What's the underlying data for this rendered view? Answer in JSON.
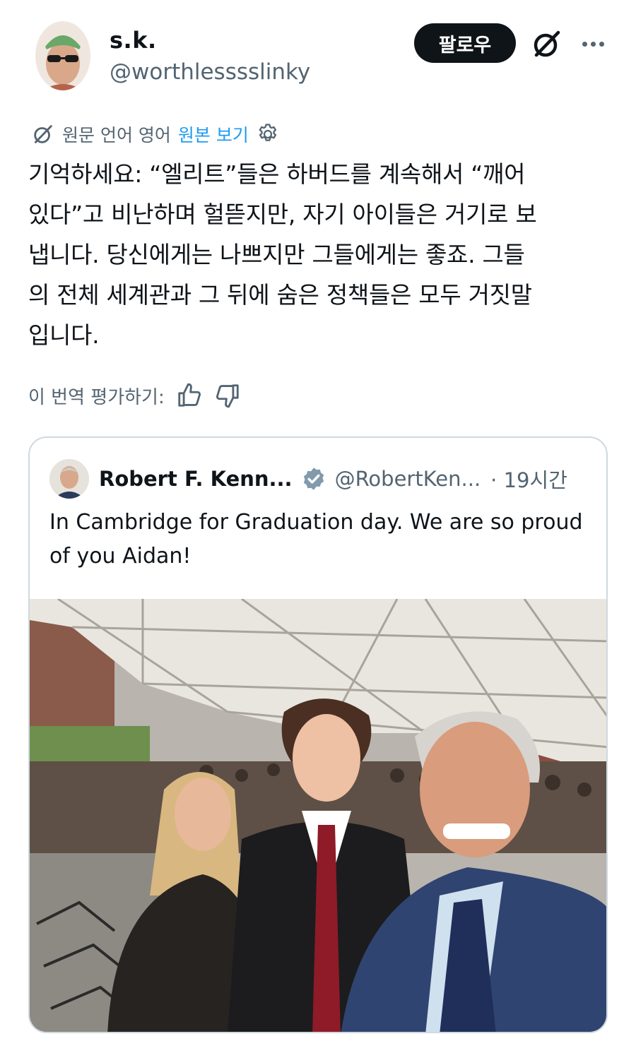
{
  "author": {
    "display_name": "s.k.",
    "handle": "@worthlesssslinky",
    "follow_label": "팔로우"
  },
  "translation": {
    "source_label": "원문 언어 영어",
    "show_original": "원본 보기"
  },
  "tweet": {
    "lines": [
      "기억하세요: “엘리트”들은 하버드를 계속해서 “깨어",
      "있다”고 비난하며 헐뜯지만, 자기 아이들은 거기로 보",
      "냅니다. 당신에게는 나쁘지만 그들에게는 좋죠. 그들",
      "의 전체 세계관과 그 뒤에 숨은 정책들은 모두 거짓말",
      "입니다."
    ]
  },
  "rate": {
    "label": "이 번역 평가하기:"
  },
  "quote": {
    "name": "Robert F. Kenn...",
    "handle": "@RobertKen...",
    "time": "· 19시간",
    "text": "In Cambridge for Graduation day. We are so proud of you Aidan!"
  },
  "colors": {
    "text": "#0f1419",
    "secondary": "#536471",
    "link": "#1d9bf0",
    "border": "#cfd9de",
    "verified_badge": "#829aab"
  },
  "icons": {
    "grok": "slashed-circle-icon",
    "more": "ellipsis-icon",
    "translate": "slashed-circle-icon",
    "settings": "gear-icon",
    "like": "thumbs-up-icon",
    "dislike": "thumbs-down-icon",
    "verified": "verified-badge-icon"
  }
}
